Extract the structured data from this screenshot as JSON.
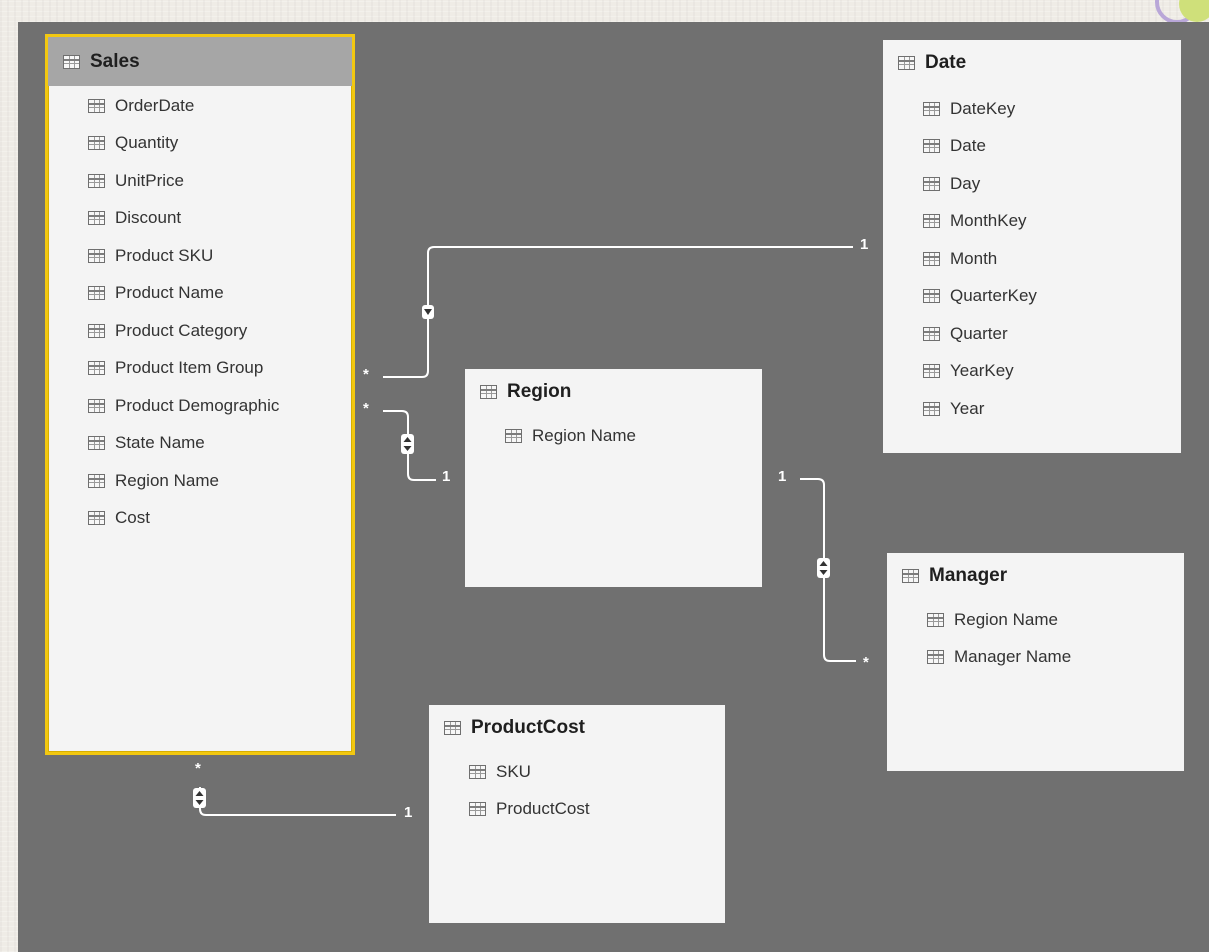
{
  "tables": {
    "sales": {
      "title": "Sales",
      "columns": [
        "OrderDate",
        "Quantity",
        "UnitPrice",
        "Discount",
        "Product SKU",
        "Product Name",
        "Product Category",
        "Product Item Group",
        "Product Demographic",
        "State Name",
        "Region Name",
        "Cost"
      ]
    },
    "date": {
      "title": "Date",
      "columns": [
        "DateKey",
        "Date",
        "Day",
        "MonthKey",
        "Month",
        "QuarterKey",
        "Quarter",
        "YearKey",
        "Year"
      ]
    },
    "region": {
      "title": "Region",
      "columns": [
        "Region Name"
      ]
    },
    "manager": {
      "title": "Manager",
      "columns": [
        "Region Name",
        "Manager Name"
      ]
    },
    "productcost": {
      "title": "ProductCost",
      "columns": [
        "SKU",
        "ProductCost"
      ]
    }
  },
  "relationships": {
    "sales_date": {
      "from_card": "*",
      "to_card": "1"
    },
    "sales_region": {
      "from_card": "*",
      "to_card": "1"
    },
    "region_manager": {
      "from_card": "1",
      "to_card": "*"
    },
    "sales_productcost": {
      "from_card": "*",
      "to_card": "1"
    }
  },
  "colors": {
    "canvas": "#707070",
    "selected_border": "#f2c811",
    "card": "#f4f4f4",
    "line": "#ffffff"
  },
  "icons": {
    "table": "table-icon",
    "column": "column-icon",
    "filter_direction": "filter-direction-icon"
  }
}
